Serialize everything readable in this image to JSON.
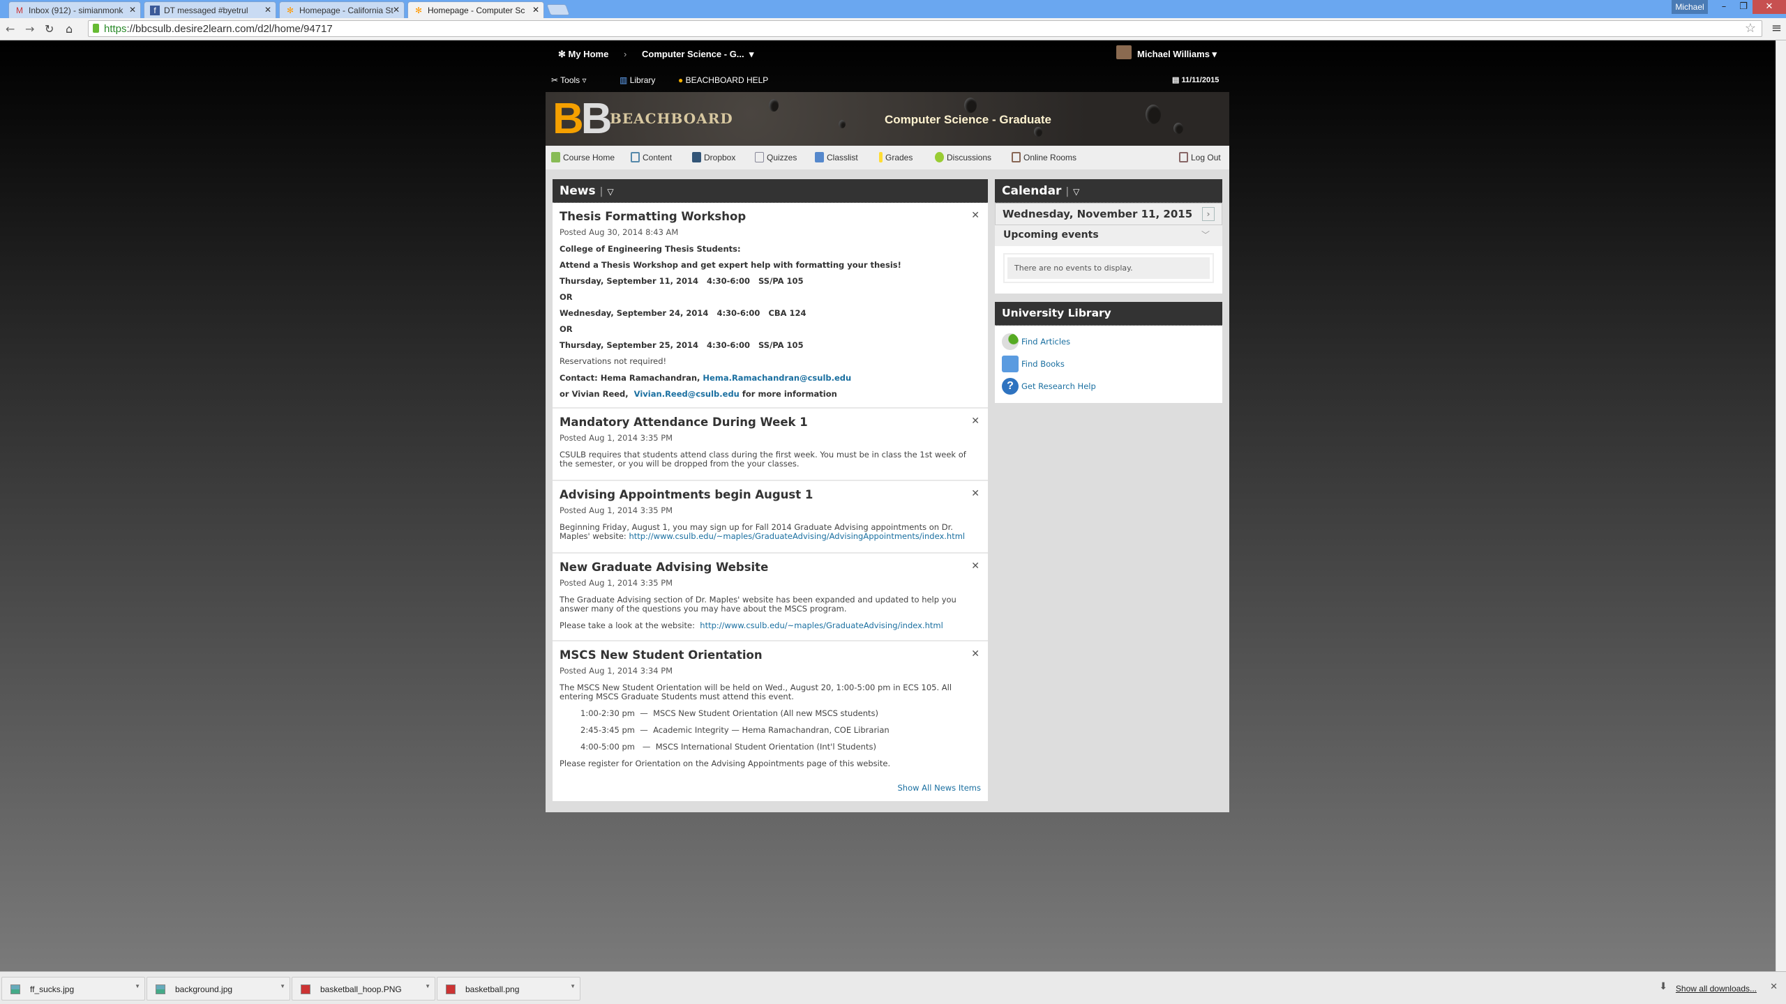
{
  "browser": {
    "tabs": [
      {
        "label": "Inbox (912) - simianmonk",
        "icon": "gmail-icon"
      },
      {
        "label": "DT messaged #byetrul",
        "icon": "facebook-icon"
      },
      {
        "label": "Homepage - California St",
        "icon": "d2l-icon"
      },
      {
        "label": "Homepage - Computer Sc",
        "icon": "d2l-icon"
      }
    ],
    "profile": "Michael",
    "url_scheme": "https",
    "url_rest": "://bbcsulb.desire2learn.com/d2l/home/94717"
  },
  "nav": {
    "home": "My Home",
    "course": "Computer Science - G...",
    "user": "Michael Williams"
  },
  "tools": {
    "tools": "Tools",
    "library": "Library",
    "help": "BEACHBOARD HELP",
    "date": "11/11/2015"
  },
  "banner": {
    "logo": "BB",
    "logo_text": "BEACHBOARD",
    "course_title": "Computer Science - Graduate"
  },
  "coursenav": [
    "Course Home",
    "Content",
    "Dropbox",
    "Quizzes",
    "Classlist",
    "Grades",
    "Discussions",
    "Online Rooms"
  ],
  "logout": "Log Out",
  "news": {
    "title": "News",
    "items": [
      {
        "title": "Thesis Formatting Workshop",
        "posted": "Posted Aug 30, 2014 8:43 AM",
        "l1": "College of Engineering Thesis Students:",
        "l2": "Attend a Thesis Workshop and get expert help with formatting your thesis!",
        "l3": "Thursday, September 11, 2014   4:30-6:00   SS/PA 105",
        "l4": "OR",
        "l5": "Wednesday, September 24, 2014   4:30-6:00   CBA 124",
        "l6": "OR",
        "l7": "Thursday, September 25, 2014   4:30-6:00   SS/PA 105",
        "l8": "Reservations not required!",
        "contact1": "Contact: Hema Ramachandran, ",
        "email1": "Hema.Ramachandran@csulb.edu",
        "contact2": "or Vivian Reed,  ",
        "email2": "Vivian.Reed@csulb.edu",
        "contact2_tail": " for more information"
      },
      {
        "title": "Mandatory Attendance During Week 1",
        "posted": "Posted Aug 1, 2014 3:35 PM",
        "body": "CSULB requires that students attend class during the first week. You must be in class the 1st week of the semester, or you will be dropped from the your classes."
      },
      {
        "title": "Advising Appointments begin August 1",
        "posted": "Posted Aug 1, 2014 3:35 PM",
        "body": "Beginning Friday, August 1, you may sign up for Fall 2014 Graduate Advising appointments on Dr. Maples' website: ",
        "link": "http://www.csulb.edu/~maples/GraduateAdvising/AdvisingAppointments/index.html"
      },
      {
        "title": "New Graduate Advising Website",
        "posted": "Posted Aug 1, 2014 3:35 PM",
        "body": "The Graduate Advising section of Dr. Maples' website has been expanded and updated to help you answer many of the questions you may have about the MSCS program.",
        "body2": "Please take a look at the website:  ",
        "link": "http://www.csulb.edu/~maples/GraduateAdvising/index.html"
      },
      {
        "title": "MSCS New Student Orientation",
        "posted": "Posted Aug 1, 2014 3:34 PM",
        "body": "The MSCS New Student Orientation will be held on Wed., August 20, 1:00-5:00 pm in ECS 105. All entering MSCS Graduate Students must attend this event.",
        "s1": "1:00-2:30 pm  —  MSCS New Student Orientation (All new MSCS students)",
        "s2": "2:45-3:45 pm  —  Academic Integrity — Hema Ramachandran, COE Librarian",
        "s3": "4:00-5:00 pm   —  MSCS International Student Orientation (Int'l Students)",
        "body3": "Please register for Orientation on the Advising Appointments page of this website."
      }
    ],
    "show_all": "Show All News Items"
  },
  "calendar": {
    "title": "Calendar",
    "date": "Wednesday, November 11, 2015",
    "upcoming": "Upcoming events",
    "empty": "There are no events to display."
  },
  "library": {
    "title": "University Library",
    "items": [
      "Find Articles",
      "Find Books",
      "Get Research Help"
    ]
  },
  "downloads": {
    "files": [
      "ff_sucks.jpg",
      "background.jpg",
      "basketball_hoop.PNG",
      "basketball.png"
    ],
    "show_all": "Show all downloads..."
  }
}
